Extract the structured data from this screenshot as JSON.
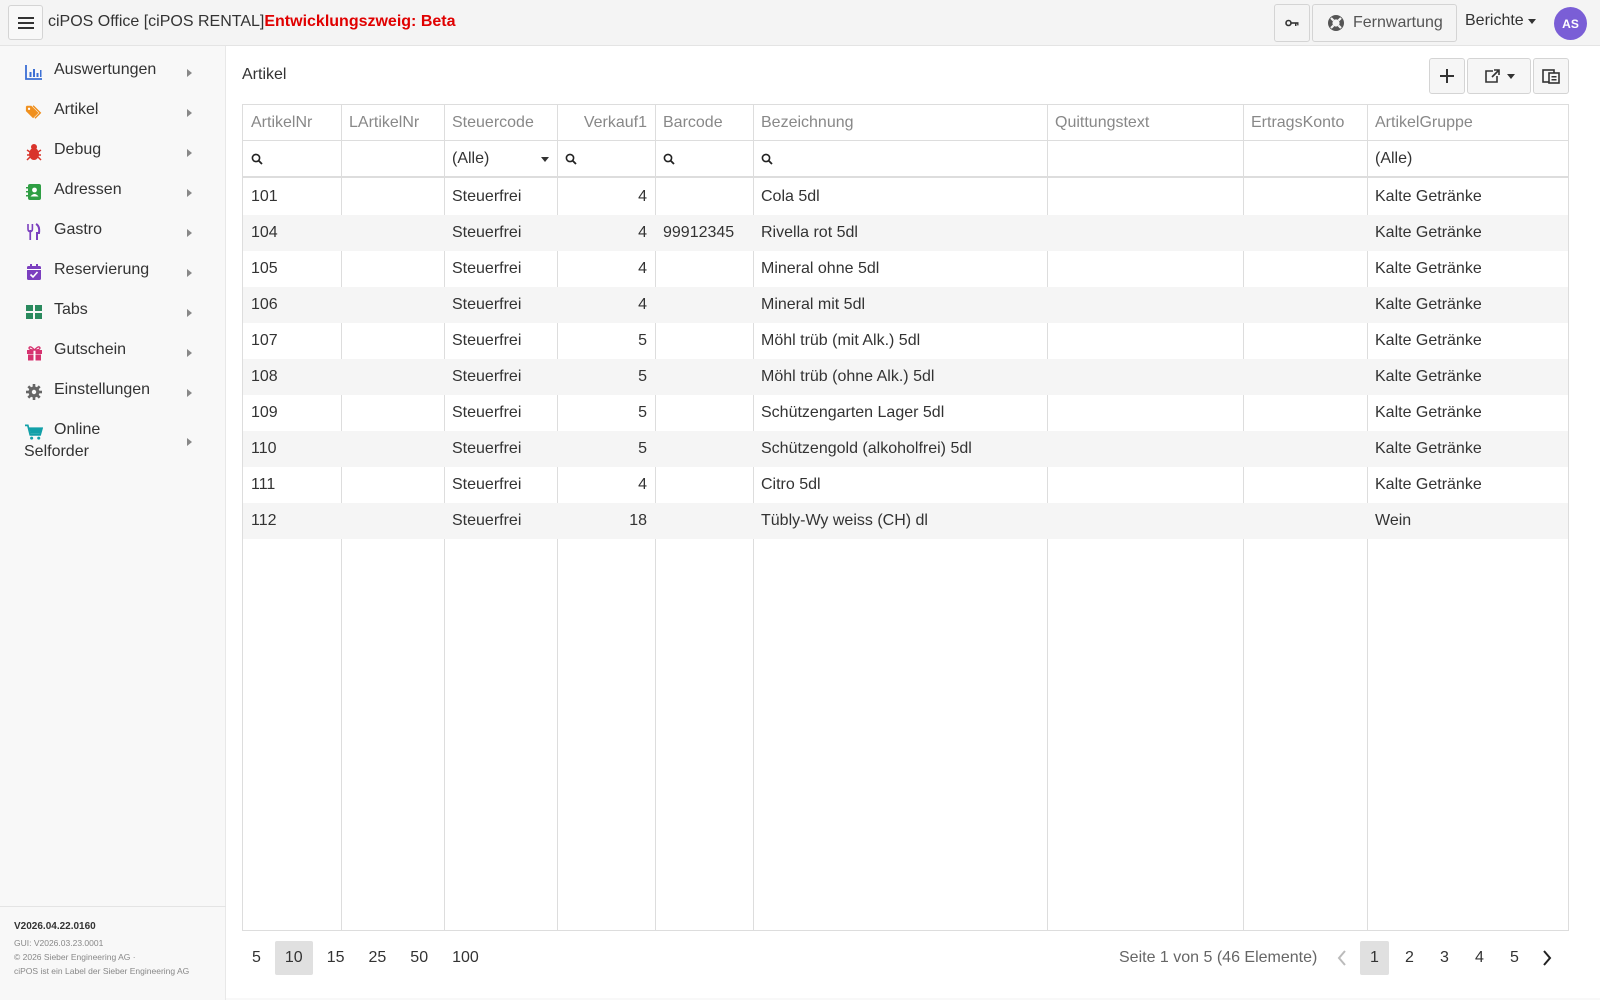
{
  "header": {
    "app_title": "ciPOS Office [ciPOS RENTAL]",
    "branch": "Entwicklungszweig: Beta",
    "remote_label": "Fernwartung",
    "reports_label": "Berichte",
    "avatar_initials": "AS"
  },
  "sidebar": {
    "items": [
      {
        "label": "Auswertungen",
        "icon": "chart-bar-icon",
        "color": "#3b6fd4"
      },
      {
        "label": "Artikel",
        "icon": "tags-icon",
        "color": "#f0901e"
      },
      {
        "label": "Debug",
        "icon": "bug-icon",
        "color": "#d9342b"
      },
      {
        "label": "Adressen",
        "icon": "address-book-icon",
        "color": "#2f9e44"
      },
      {
        "label": "Gastro",
        "icon": "utensils-icon",
        "color": "#7b3fbf"
      },
      {
        "label": "Reservierung",
        "icon": "calendar-check-icon",
        "color": "#7b3fbf"
      },
      {
        "label": "Tabs",
        "icon": "th-large-icon",
        "color": "#2a8a5e"
      },
      {
        "label": "Gutschein",
        "icon": "gift-icon",
        "color": "#d63370"
      },
      {
        "label": "Einstellungen",
        "icon": "gear-icon",
        "color": "#666666"
      },
      {
        "label_line1": "Online",
        "label_line2": "Selforder",
        "icon": "shopping-cart-icon",
        "color": "#12a0a8"
      }
    ],
    "footer": {
      "version": "V2026.04.22.0160",
      "gui_version": "GUI: V2026.03.23.0001",
      "copyright": "© 2026 Sieber Engineering AG ·",
      "label": "ciPOS ist ein Label der Sieber Engineering AG"
    }
  },
  "main": {
    "title": "Artikel",
    "columns": [
      "ArtikelNr",
      "LArtikelNr",
      "Steuercode",
      "Verkauf1",
      "Barcode",
      "Bezeichnung",
      "Quittungstext",
      "ErtragsKonto",
      "ArtikelGruppe"
    ],
    "filters": {
      "steuercode": "(Alle)",
      "artikelgruppe": "(Alle)"
    },
    "rows": [
      {
        "nr": "101",
        "lnr": "",
        "steuer": "Steuerfrei",
        "vk": "4",
        "barcode": "",
        "bez": "Cola 5dl",
        "quittung": "",
        "konto": "",
        "gruppe": "Kalte Getränke"
      },
      {
        "nr": "104",
        "lnr": "",
        "steuer": "Steuerfrei",
        "vk": "4",
        "barcode": "99912345",
        "bez": "Rivella rot 5dl",
        "quittung": "",
        "konto": "",
        "gruppe": "Kalte Getränke"
      },
      {
        "nr": "105",
        "lnr": "",
        "steuer": "Steuerfrei",
        "vk": "4",
        "barcode": "",
        "bez": "Mineral ohne 5dl",
        "quittung": "",
        "konto": "",
        "gruppe": "Kalte Getränke"
      },
      {
        "nr": "106",
        "lnr": "",
        "steuer": "Steuerfrei",
        "vk": "4",
        "barcode": "",
        "bez": "Mineral mit 5dl",
        "quittung": "",
        "konto": "",
        "gruppe": "Kalte Getränke"
      },
      {
        "nr": "107",
        "lnr": "",
        "steuer": "Steuerfrei",
        "vk": "5",
        "barcode": "",
        "bez": "Möhl trüb (mit Alk.) 5dl",
        "quittung": "",
        "konto": "",
        "gruppe": "Kalte Getränke"
      },
      {
        "nr": "108",
        "lnr": "",
        "steuer": "Steuerfrei",
        "vk": "5",
        "barcode": "",
        "bez": "Möhl trüb (ohne Alk.) 5dl",
        "quittung": "",
        "konto": "",
        "gruppe": "Kalte Getränke"
      },
      {
        "nr": "109",
        "lnr": "",
        "steuer": "Steuerfrei",
        "vk": "5",
        "barcode": "",
        "bez": "Schützengarten Lager 5dl",
        "quittung": "",
        "konto": "",
        "gruppe": "Kalte Getränke"
      },
      {
        "nr": "110",
        "lnr": "",
        "steuer": "Steuerfrei",
        "vk": "5",
        "barcode": "",
        "bez": "Schützengold (alkoholfrei) 5dl",
        "quittung": "",
        "konto": "",
        "gruppe": "Kalte Getränke"
      },
      {
        "nr": "111",
        "lnr": "",
        "steuer": "Steuerfrei",
        "vk": "4",
        "barcode": "",
        "bez": "Citro 5dl",
        "quittung": "",
        "konto": "",
        "gruppe": "Kalte Getränke"
      },
      {
        "nr": "112",
        "lnr": "",
        "steuer": "Steuerfrei",
        "vk": "18",
        "barcode": "",
        "bez": "Tübly-Wy weiss (CH) dl",
        "quittung": "",
        "konto": "",
        "gruppe": "Wein"
      }
    ]
  },
  "pager": {
    "page_sizes": [
      "5",
      "10",
      "15",
      "25",
      "50",
      "100"
    ],
    "selected_size": "10",
    "info": "Seite 1 von 5 (46 Elemente)",
    "pages": [
      "1",
      "2",
      "3",
      "4",
      "5"
    ],
    "current_page": "1"
  }
}
